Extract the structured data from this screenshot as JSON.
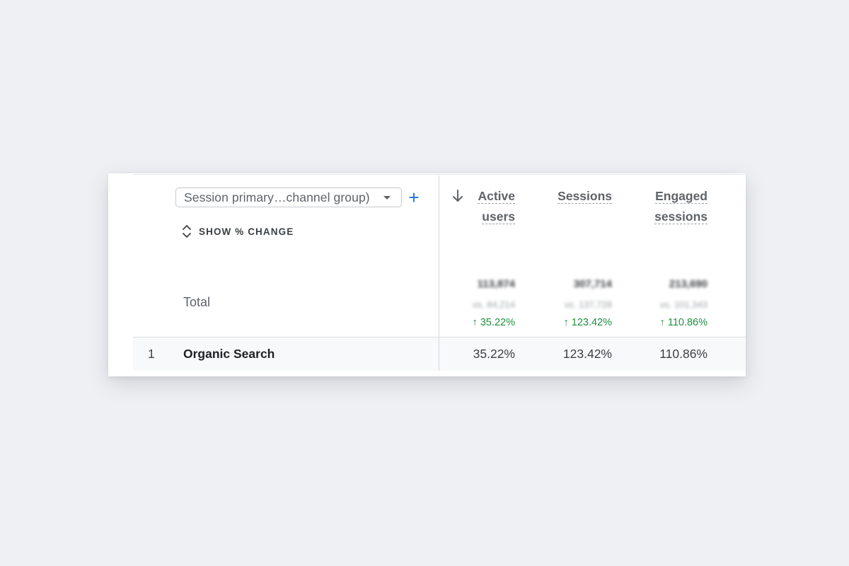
{
  "dimension_selector": {
    "label": "Session primary…channel group)",
    "add_symbol": "+"
  },
  "show_change": {
    "label": "SHOW % CHANGE"
  },
  "icons": {
    "sort": "arrow-down-icon",
    "toggle": "unfold-icon",
    "caret": "caret-down-icon",
    "change": "arrow-up-icon"
  },
  "columns": [
    {
      "name_line1": "Active",
      "name_line2": "users",
      "sorted": true
    },
    {
      "name_line1": "Sessions",
      "name_line2": ""
    },
    {
      "name_line1": "Engaged",
      "name_line2": "sessions"
    }
  ],
  "total": {
    "label": "Total",
    "values": [
      "113,874",
      "307,714",
      "213,690"
    ],
    "comparisons": [
      "vs. 84,214",
      "vs. 137,728",
      "vs. 101,343"
    ],
    "changes": [
      "35.22%",
      "123.42%",
      "110.86%"
    ]
  },
  "rows": [
    {
      "index": "1",
      "name": "Organic Search",
      "values": [
        "35.22%",
        "123.42%",
        "110.86%"
      ]
    }
  ],
  "colors": {
    "accent": "#1a73e8",
    "positive": "#1e8e3e",
    "background": "#eff0f4"
  }
}
